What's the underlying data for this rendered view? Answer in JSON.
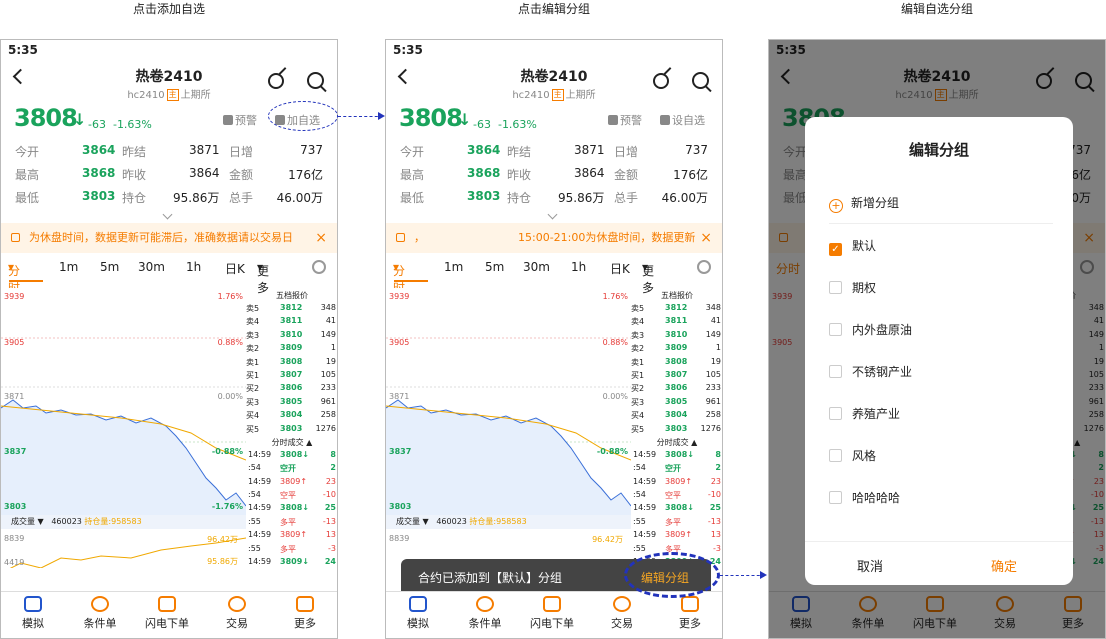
{
  "captions": [
    "点击添加自选",
    "点击编辑分组",
    "编辑自选分组"
  ],
  "status_time": "5:35",
  "title": "热卷2410",
  "code": "hc2410",
  "tag": "主",
  "exchange": "上期所",
  "price": "3808",
  "change": "-63",
  "change_pct": "-1.63%",
  "alert_label": "预警",
  "fav_label_1": "加自选",
  "fav_label_2": "设自选",
  "stats": [
    {
      "l1": "今开",
      "v1": "3864",
      "l2": "昨结",
      "v2": "3871",
      "l3": "日增",
      "v3": "737"
    },
    {
      "l1": "最高",
      "v1": "3868",
      "l2": "昨收",
      "v2": "3864",
      "l3": "金额",
      "v3": "176亿"
    },
    {
      "l1": "最低",
      "v1": "3803",
      "l2": "持仓",
      "v2": "95.86万",
      "l3": "总手",
      "v3": "46.00万"
    }
  ],
  "notice_1": "为休盘时间，数据更新可能滞后，准确数据请以交易日",
  "notice_2": "15:00-21:00为休盘时间，数据更新",
  "notice_2_prefix": "，",
  "tabs": [
    "分时",
    "1m",
    "5m",
    "30m",
    "1h",
    "日K",
    "更多"
  ],
  "axis": {
    "p1": "3939",
    "p2": "3905",
    "p3": "3871",
    "p4": "3837",
    "p5": "3803",
    "pc1": "1.76%",
    "pc2": "0.88%",
    "pc3": "0.00%",
    "pc4": "-0.88%",
    "pc5": "-1.76%"
  },
  "orderbook_title": "五档报价",
  "orderbook": [
    {
      "s": "卖5",
      "p": "3812",
      "v": "348"
    },
    {
      "s": "卖4",
      "p": "3811",
      "v": "41"
    },
    {
      "s": "卖3",
      "p": "3810",
      "v": "149"
    },
    {
      "s": "卖2",
      "p": "3809",
      "v": "1"
    },
    {
      "s": "卖1",
      "p": "3808",
      "v": "19"
    },
    {
      "s": "买1",
      "p": "3807",
      "v": "105"
    },
    {
      "s": "买2",
      "p": "3806",
      "v": "233"
    },
    {
      "s": "买3",
      "p": "3805",
      "v": "961"
    },
    {
      "s": "买4",
      "p": "3804",
      "v": "258"
    },
    {
      "s": "买5",
      "p": "3803",
      "v": "1276"
    }
  ],
  "trades_title": "分时成交",
  "trades": [
    {
      "t": "14:59",
      "p": "3808↓",
      "v": "8"
    },
    {
      "t": ":54",
      "p": "空开",
      "v": "2"
    },
    {
      "t": "14:59",
      "p": "3809↑",
      "v": "23"
    },
    {
      "t": ":54",
      "p": "空平",
      "v": "-10"
    },
    {
      "t": "14:59",
      "p": "3808↓",
      "v": "25"
    },
    {
      "t": ":55",
      "p": "多平",
      "v": "-13"
    },
    {
      "t": "14:59",
      "p": "3809↑",
      "v": "13"
    },
    {
      "t": ":55",
      "p": "多平",
      "v": "-3"
    },
    {
      "t": "14:59",
      "p": "3809↓",
      "v": "24"
    }
  ],
  "vol_label": "成交量",
  "vol_value": "460023",
  "oi_label": "持仓量:958583",
  "vol_axis": [
    "8839",
    "4419"
  ],
  "vol_right": "96.42万",
  "vol_right2": "95.86万",
  "nav": [
    "模拟",
    "条件单",
    "闪电下单",
    "交易",
    "更多"
  ],
  "toast_text": "合约已添加到【默认】分组",
  "toast_action": "编辑分组",
  "dialog": {
    "title": "编辑分组",
    "add": "新增分组",
    "groups": [
      {
        "name": "默认",
        "checked": true
      },
      {
        "name": "期权",
        "checked": false
      },
      {
        "name": "内外盘原油",
        "checked": false
      },
      {
        "name": "不锈钢产业",
        "checked": false
      },
      {
        "name": "养殖产业",
        "checked": false
      },
      {
        "name": "风格",
        "checked": false
      },
      {
        "name": "哈哈哈哈",
        "checked": false
      }
    ],
    "cancel": "取消",
    "ok": "确定"
  },
  "colors": {
    "green": "#1aa35c",
    "red": "#e53935",
    "orange": "#f57c00",
    "annot": "#2233bb"
  }
}
